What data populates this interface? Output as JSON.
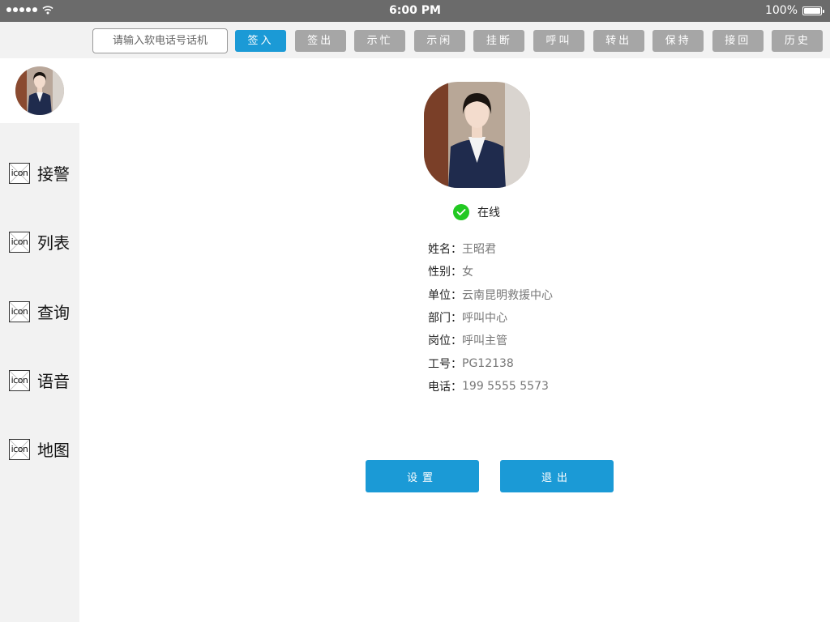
{
  "status_bar": {
    "time": "6:00 PM",
    "battery": "100%",
    "battery_level": 1.0
  },
  "toolbar": {
    "phone_placeholder": "请输入软电话号话机",
    "buttons": [
      "签入",
      "签出",
      "示忙",
      "示闲",
      "挂断",
      "呼叫",
      "转出",
      "保持",
      "接回",
      "历史"
    ],
    "active_button": "签入",
    "accent_color": "#1b9ad6",
    "inactive_color": "#a6a6a6"
  },
  "sidebar": {
    "items": [
      {
        "icon": "icon",
        "label": "接警"
      },
      {
        "icon": "icon",
        "label": "列表"
      },
      {
        "icon": "icon",
        "label": "查询"
      },
      {
        "icon": "icon",
        "label": "语音"
      },
      {
        "icon": "icon",
        "label": "地图"
      }
    ]
  },
  "profile": {
    "status": "在线",
    "status_color": "#22c922",
    "fields": [
      {
        "label": "姓名：",
        "value": "王昭君"
      },
      {
        "label": "性别：",
        "value": "女"
      },
      {
        "label": "单位：",
        "value": "云南昆明救援中心"
      },
      {
        "label": "部门：",
        "value": "呼叫中心"
      },
      {
        "label": "岗位：",
        "value": "呼叫主管"
      },
      {
        "label": "工号：",
        "value": "PG12138"
      },
      {
        "label": "电话：",
        "value": "199 5555 5573"
      }
    ]
  },
  "actions": {
    "settings": "设置",
    "logout": "退出"
  }
}
